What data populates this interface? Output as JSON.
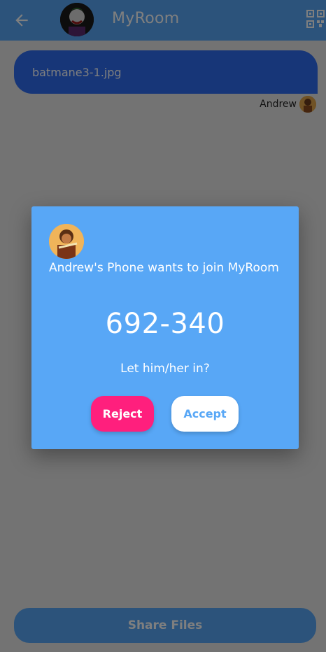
{
  "appbar": {
    "title": "MyRoom",
    "back_icon": "arrow-left-icon",
    "qr_icon": "qr-code-icon"
  },
  "messages": [
    {
      "file_name": "batmane3-1.jpg",
      "sender": "Andrew"
    }
  ],
  "footer": {
    "share_label": "Share Files"
  },
  "dialog": {
    "message": "Andrew's Phone  wants to join MyRoom",
    "code": "692-340",
    "question": "Let him/her in?",
    "reject_label": "Reject",
    "accept_label": "Accept"
  },
  "colors": {
    "primary": "#58a7f6",
    "bubble": "#2f6cf0",
    "reject": "#ff1f7d",
    "accept_bg": "#ffffff"
  }
}
